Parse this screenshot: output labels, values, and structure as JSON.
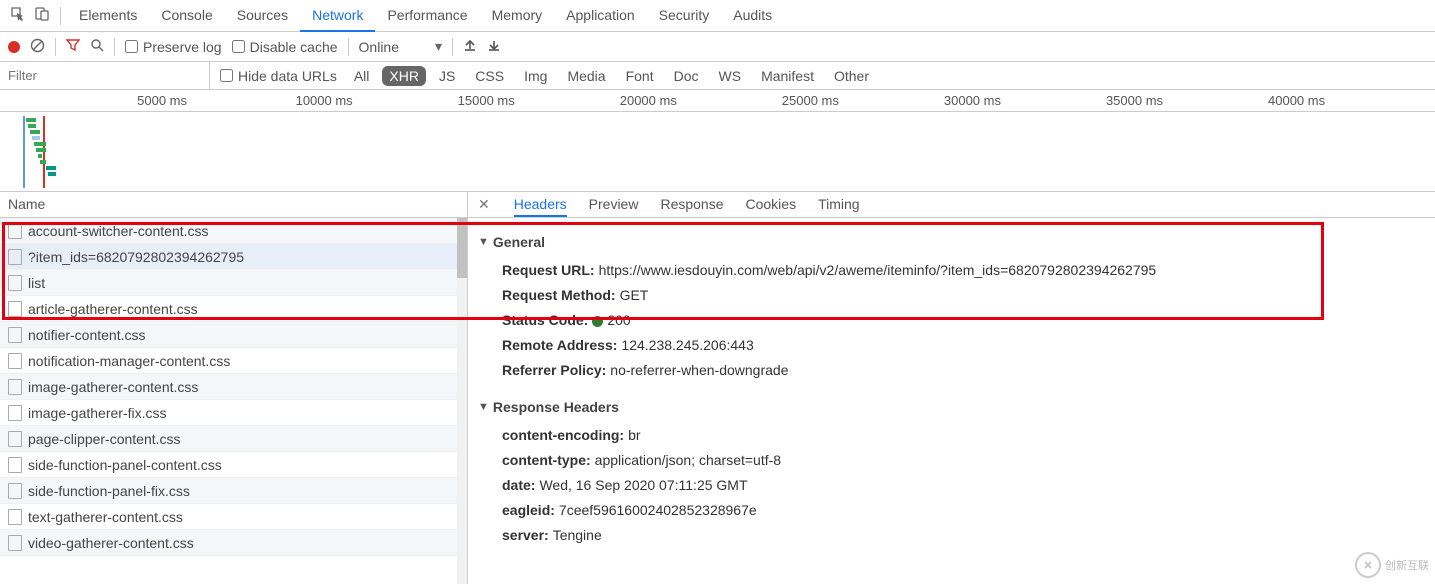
{
  "tabs": [
    "Elements",
    "Console",
    "Sources",
    "Network",
    "Performance",
    "Memory",
    "Application",
    "Security",
    "Audits"
  ],
  "activeTab": "Network",
  "toolbar": {
    "preserve_log": "Preserve log",
    "disable_cache": "Disable cache",
    "throttling": "Online"
  },
  "filterRow": {
    "filter_placeholder": "Filter",
    "hide_data_urls": "Hide data URLs",
    "types": [
      "All",
      "XHR",
      "JS",
      "CSS",
      "Img",
      "Media",
      "Font",
      "Doc",
      "WS",
      "Manifest",
      "Other"
    ],
    "activeType": "XHR"
  },
  "ticks": [
    "5000 ms",
    "10000 ms",
    "15000 ms",
    "20000 ms",
    "25000 ms",
    "30000 ms",
    "35000 ms",
    "40000 ms"
  ],
  "nameHeader": "Name",
  "detailTabs": [
    "Headers",
    "Preview",
    "Response",
    "Cookies",
    "Timing"
  ],
  "activeDetailTab": "Headers",
  "requests": [
    "account-switcher-content.css",
    "?item_ids=6820792802394262795",
    "list",
    "article-gatherer-content.css",
    "notifier-content.css",
    "notification-manager-content.css",
    "image-gatherer-content.css",
    "image-gatherer-fix.css",
    "page-clipper-content.css",
    "side-function-panel-content.css",
    "side-function-panel-fix.css",
    "text-gatherer-content.css",
    "video-gatherer-content.css"
  ],
  "selectedRequestIndex": 1,
  "headers": {
    "generalTitle": "General",
    "general": {
      "request_url_k": "Request URL:",
      "request_url_v": "https://www.iesdouyin.com/web/api/v2/aweme/iteminfo/?item_ids=6820792802394262795",
      "request_method_k": "Request Method:",
      "request_method_v": "GET",
      "status_code_k": "Status Code:",
      "status_code_v": "200",
      "remote_address_k": "Remote Address:",
      "remote_address_v": "124.238.245.206:443",
      "referrer_policy_k": "Referrer Policy:",
      "referrer_policy_v": "no-referrer-when-downgrade"
    },
    "responseTitle": "Response Headers",
    "response": {
      "content_encoding_k": "content-encoding:",
      "content_encoding_v": "br",
      "content_type_k": "content-type:",
      "content_type_v": "application/json; charset=utf-8",
      "date_k": "date:",
      "date_v": "Wed, 16 Sep 2020 07:11:25 GMT",
      "eagleid_k": "eagleid:",
      "eagleid_v": "7ceef59616002402852328967e",
      "server_k": "server:",
      "server_v": "Tengine"
    }
  },
  "watermark": "创新互联"
}
